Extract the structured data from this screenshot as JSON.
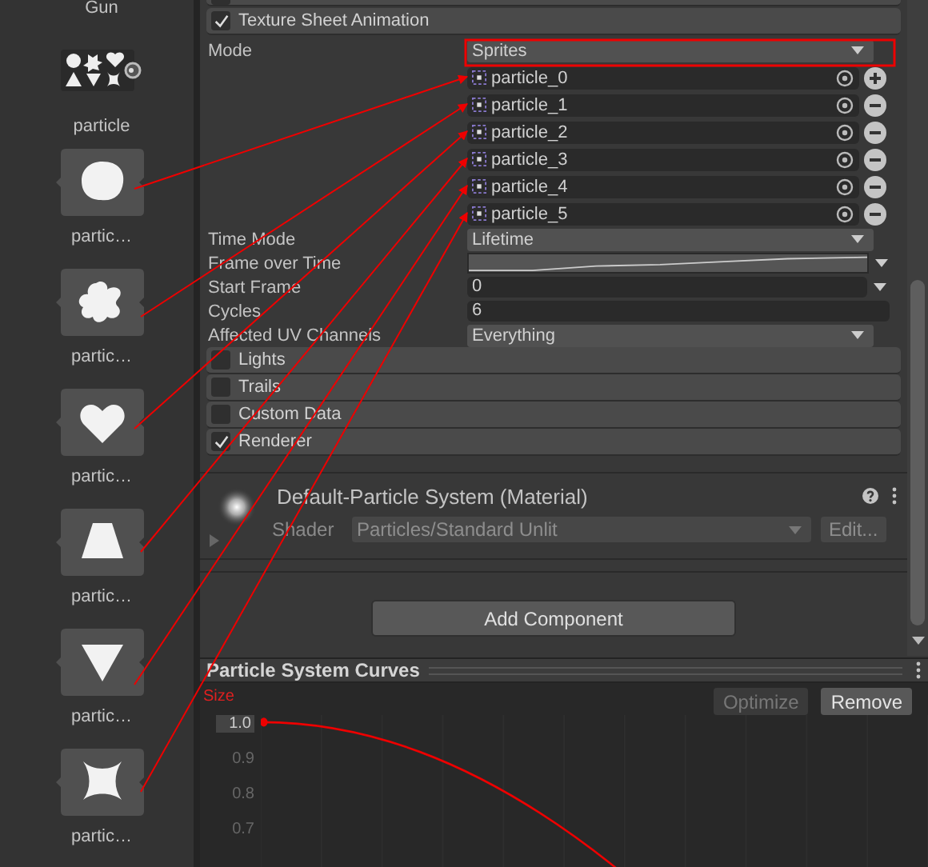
{
  "assets": {
    "top_label": "Gun",
    "items": [
      {
        "label": "particle",
        "kind": "sheet"
      },
      {
        "label": "partic…",
        "kind": "sprite"
      },
      {
        "label": "partic…",
        "kind": "sprite"
      },
      {
        "label": "partic…",
        "kind": "sprite"
      },
      {
        "label": "partic…",
        "kind": "sprite"
      },
      {
        "label": "partic…",
        "kind": "sprite"
      },
      {
        "label": "partic…",
        "kind": "sprite"
      }
    ]
  },
  "module_above": {
    "checked": false
  },
  "texture_sheet": {
    "label": "Texture Sheet Animation",
    "checked": true,
    "mode_label": "Mode",
    "mode_value": "Sprites",
    "sprites": [
      {
        "name": "particle_0",
        "kind": "add"
      },
      {
        "name": "particle_1",
        "kind": "remove"
      },
      {
        "name": "particle_2",
        "kind": "remove"
      },
      {
        "name": "particle_3",
        "kind": "remove"
      },
      {
        "name": "particle_4",
        "kind": "remove"
      },
      {
        "name": "particle_5",
        "kind": "remove"
      }
    ],
    "properties": [
      {
        "label": "Time Mode",
        "kind": "dropdown",
        "value": "Lifetime"
      },
      {
        "label": "Frame over Time",
        "kind": "curve"
      },
      {
        "label": "Start Frame",
        "kind": "number_dropdown",
        "value": "0"
      },
      {
        "label": "Cycles",
        "kind": "number",
        "value": "6"
      },
      {
        "label": "Affected UV Channels",
        "kind": "dropdown",
        "value": "Everything"
      }
    ]
  },
  "modules": [
    {
      "label": "Lights",
      "checked": false
    },
    {
      "label": "Trails",
      "checked": false
    },
    {
      "label": "Custom Data",
      "checked": false
    },
    {
      "label": "Renderer",
      "checked": true
    }
  ],
  "material": {
    "title": "Default-Particle System (Material)",
    "shader_label": "Shader",
    "shader_value": "Particles/Standard Unlit",
    "edit_button": "Edit..."
  },
  "add_component": "Add Component",
  "curves": {
    "title": "Particle System Curves",
    "buttons": [
      {
        "label": "Optimize",
        "disabled": true
      },
      {
        "label": "Remove",
        "disabled": false
      }
    ],
    "curve_label": "Size",
    "y_labels": [
      "1.0",
      "0.9",
      "0.8",
      "0.7"
    ]
  }
}
